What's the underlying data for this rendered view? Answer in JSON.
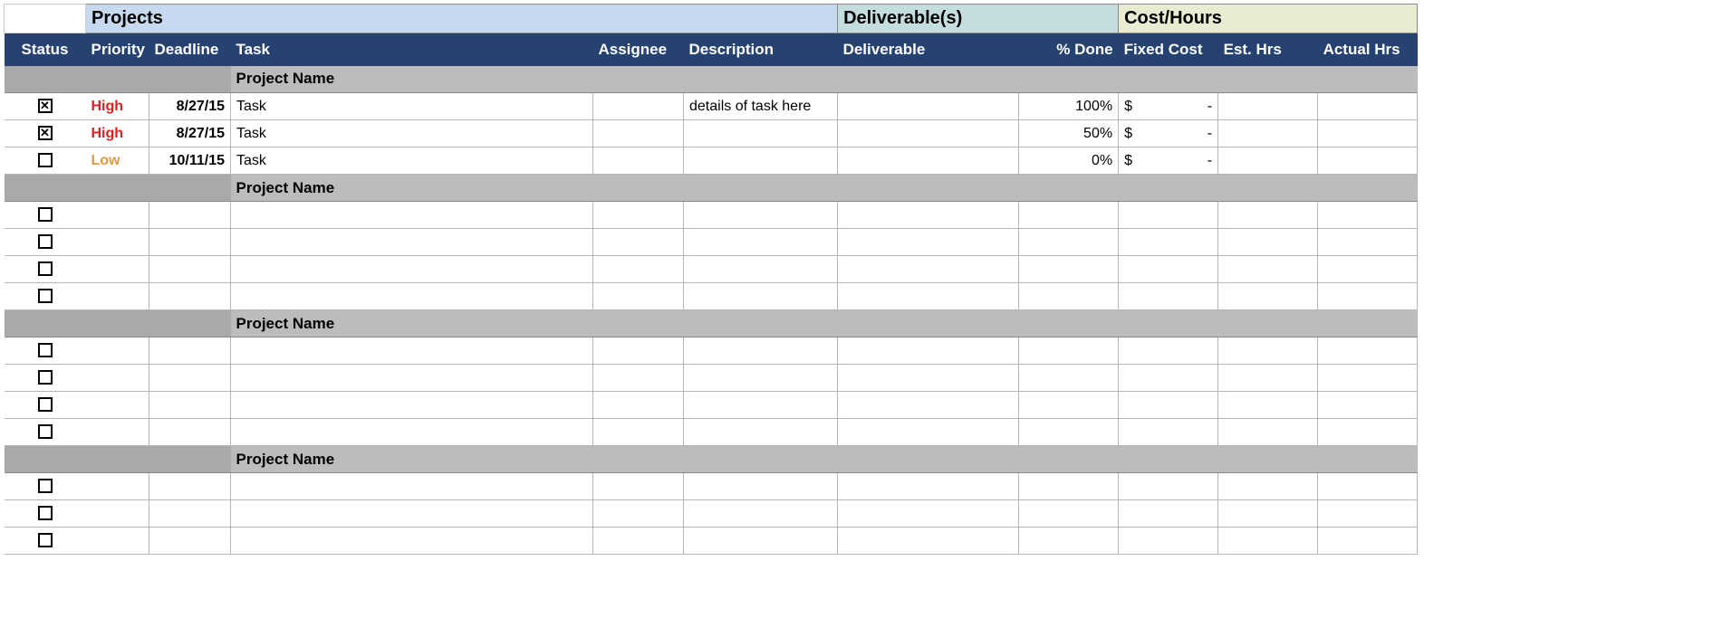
{
  "sections": {
    "projects": "Projects",
    "deliverables": "Deliverable(s)",
    "cost": "Cost/Hours"
  },
  "columns": {
    "status": "Status",
    "priority": "Priority",
    "deadline": "Deadline",
    "task": "Task",
    "assignee": "Assignee",
    "description": "Description",
    "deliverable": "Deliverable",
    "pct_done": "% Done",
    "fixed_cost": "Fixed Cost",
    "est_hrs": "Est. Hrs",
    "actual_hrs": "Actual Hrs"
  },
  "groups": [
    {
      "name": "Project Name",
      "rows": [
        {
          "checked": true,
          "priority": "High",
          "priority_class": "priority-high",
          "deadline": "8/27/15",
          "task": "Task",
          "assignee": "",
          "description": "details of task here",
          "deliverable": "",
          "pct_done": "100%",
          "fixed_cost_sym": "$",
          "fixed_cost_val": "-",
          "est_hrs": "",
          "actual_hrs": ""
        },
        {
          "checked": true,
          "priority": "High",
          "priority_class": "priority-high",
          "deadline": "8/27/15",
          "task": "Task",
          "assignee": "",
          "description": "",
          "deliverable": "",
          "pct_done": "50%",
          "fixed_cost_sym": "$",
          "fixed_cost_val": "-",
          "est_hrs": "",
          "actual_hrs": ""
        },
        {
          "checked": false,
          "priority": "Low",
          "priority_class": "priority-low",
          "deadline": "10/11/15",
          "task": "Task",
          "assignee": "",
          "description": "",
          "deliverable": "",
          "pct_done": "0%",
          "fixed_cost_sym": "$",
          "fixed_cost_val": "-",
          "est_hrs": "",
          "actual_hrs": ""
        }
      ]
    },
    {
      "name": "Project Name",
      "rows": [
        {
          "checked": false,
          "priority": "",
          "priority_class": "",
          "deadline": "",
          "task": "",
          "assignee": "",
          "description": "",
          "deliverable": "",
          "pct_done": "",
          "fixed_cost_sym": "",
          "fixed_cost_val": "",
          "est_hrs": "",
          "actual_hrs": ""
        },
        {
          "checked": false,
          "priority": "",
          "priority_class": "",
          "deadline": "",
          "task": "",
          "assignee": "",
          "description": "",
          "deliverable": "",
          "pct_done": "",
          "fixed_cost_sym": "",
          "fixed_cost_val": "",
          "est_hrs": "",
          "actual_hrs": ""
        },
        {
          "checked": false,
          "priority": "",
          "priority_class": "",
          "deadline": "",
          "task": "",
          "assignee": "",
          "description": "",
          "deliverable": "",
          "pct_done": "",
          "fixed_cost_sym": "",
          "fixed_cost_val": "",
          "est_hrs": "",
          "actual_hrs": ""
        },
        {
          "checked": false,
          "priority": "",
          "priority_class": "",
          "deadline": "",
          "task": "",
          "assignee": "",
          "description": "",
          "deliverable": "",
          "pct_done": "",
          "fixed_cost_sym": "",
          "fixed_cost_val": "",
          "est_hrs": "",
          "actual_hrs": ""
        }
      ]
    },
    {
      "name": "Project Name",
      "rows": [
        {
          "checked": false,
          "priority": "",
          "priority_class": "",
          "deadline": "",
          "task": "",
          "assignee": "",
          "description": "",
          "deliverable": "",
          "pct_done": "",
          "fixed_cost_sym": "",
          "fixed_cost_val": "",
          "est_hrs": "",
          "actual_hrs": ""
        },
        {
          "checked": false,
          "priority": "",
          "priority_class": "",
          "deadline": "",
          "task": "",
          "assignee": "",
          "description": "",
          "deliverable": "",
          "pct_done": "",
          "fixed_cost_sym": "",
          "fixed_cost_val": "",
          "est_hrs": "",
          "actual_hrs": ""
        },
        {
          "checked": false,
          "priority": "",
          "priority_class": "",
          "deadline": "",
          "task": "",
          "assignee": "",
          "description": "",
          "deliverable": "",
          "pct_done": "",
          "fixed_cost_sym": "",
          "fixed_cost_val": "",
          "est_hrs": "",
          "actual_hrs": ""
        },
        {
          "checked": false,
          "priority": "",
          "priority_class": "",
          "deadline": "",
          "task": "",
          "assignee": "",
          "description": "",
          "deliverable": "",
          "pct_done": "",
          "fixed_cost_sym": "",
          "fixed_cost_val": "",
          "est_hrs": "",
          "actual_hrs": ""
        }
      ]
    },
    {
      "name": "Project Name",
      "rows": [
        {
          "checked": false,
          "priority": "",
          "priority_class": "",
          "deadline": "",
          "task": "",
          "assignee": "",
          "description": "",
          "deliverable": "",
          "pct_done": "",
          "fixed_cost_sym": "",
          "fixed_cost_val": "",
          "est_hrs": "",
          "actual_hrs": ""
        },
        {
          "checked": false,
          "priority": "",
          "priority_class": "",
          "deadline": "",
          "task": "",
          "assignee": "",
          "description": "",
          "deliverable": "",
          "pct_done": "",
          "fixed_cost_sym": "",
          "fixed_cost_val": "",
          "est_hrs": "",
          "actual_hrs": ""
        },
        {
          "checked": false,
          "priority": "",
          "priority_class": "",
          "deadline": "",
          "task": "",
          "assignee": "",
          "description": "",
          "deliverable": "",
          "pct_done": "",
          "fixed_cost_sym": "",
          "fixed_cost_val": "",
          "est_hrs": "",
          "actual_hrs": ""
        }
      ]
    }
  ]
}
